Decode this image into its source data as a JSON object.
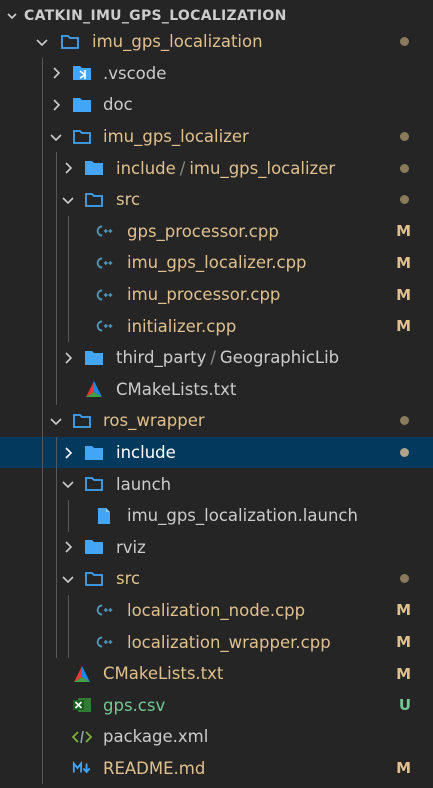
{
  "header": {
    "title": "CATKIN_IMU_GPS_LOCALIZATION"
  },
  "tree": {
    "imu_gps_localization": "imu_gps_localization",
    "vscode": ".vscode",
    "doc": "doc",
    "imu_gps_localizer": "imu_gps_localizer",
    "include_part1": "include",
    "include_part2": "imu_gps_localizer",
    "src1": "src",
    "gps_processor": "gps_processor.cpp",
    "imu_gps_localizer_cpp": "imu_gps_localizer.cpp",
    "imu_processor": "imu_processor.cpp",
    "initializer": "initializer.cpp",
    "third_party_part1": "third_party",
    "third_party_part2": "GeographicLib",
    "cmake1": "CMakeLists.txt",
    "ros_wrapper": "ros_wrapper",
    "include2": "include",
    "launch": "launch",
    "launch_file": "imu_gps_localization.launch",
    "rviz": "rviz",
    "src2": "src",
    "localization_node": "localization_node.cpp",
    "localization_wrapper": "localization_wrapper.cpp",
    "cmake2": "CMakeLists.txt",
    "gps_csv": "gps.csv",
    "package_xml": "package.xml",
    "readme": "README.md"
  },
  "status": {
    "modified": "M",
    "untracked": "U"
  },
  "colors": {
    "background": "#252526",
    "selected": "#04395e",
    "modified": "#e2c08d",
    "untracked": "#73c991",
    "folder": "#42a5f5",
    "cpp_icon": "#519aba"
  },
  "icons": {
    "folder": "folder-icon",
    "folder_open": "folder-open-icon",
    "vscode_folder": "vscode-folder-icon",
    "cpp": "cpp-file-icon",
    "cmake": "cmake-icon",
    "launch": "file-icon",
    "csv": "excel-icon",
    "xml": "code-icon",
    "markdown": "markdown-icon"
  }
}
